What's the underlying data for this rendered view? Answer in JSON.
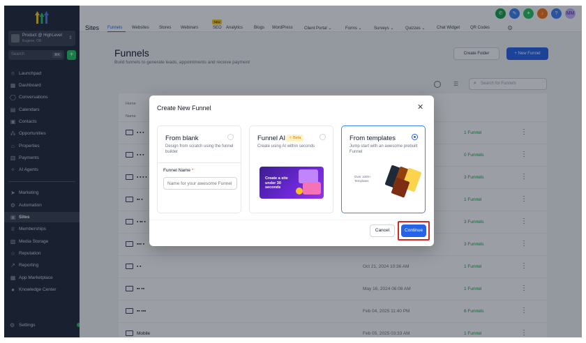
{
  "account": {
    "name": "Product @ HighLevel",
    "location": "Eugene, OR"
  },
  "sidebar": {
    "search_placeholder": "Search",
    "search_shortcut": "⌘K",
    "items": [
      {
        "label": "Launchpad",
        "icon": "rocket-icon"
      },
      {
        "label": "Dashboard",
        "icon": "dashboard-icon"
      },
      {
        "label": "Conversations",
        "icon": "chat-icon"
      },
      {
        "label": "Calendars",
        "icon": "calendar-icon"
      },
      {
        "label": "Contacts",
        "icon": "contacts-icon"
      },
      {
        "label": "Opportunities",
        "icon": "opportunities-icon"
      },
      {
        "label": "Properties",
        "icon": "properties-icon"
      },
      {
        "label": "Payments",
        "icon": "payments-icon"
      },
      {
        "label": "AI Agents",
        "icon": "ai-icon"
      }
    ],
    "items2": [
      {
        "label": "Marketing",
        "icon": "send-icon"
      },
      {
        "label": "Automation",
        "icon": "automation-icon"
      },
      {
        "label": "Sites",
        "icon": "sites-icon"
      },
      {
        "label": "Memberships",
        "icon": "membership-icon"
      },
      {
        "label": "Media Storage",
        "icon": "media-icon"
      },
      {
        "label": "Reputation",
        "icon": "star-icon"
      },
      {
        "label": "Reporting",
        "icon": "chart-icon"
      },
      {
        "label": "App Marketplace",
        "icon": "apps-icon"
      },
      {
        "label": "Knowledge Center",
        "icon": "knowledge-icon"
      }
    ],
    "settings_label": "Settings"
  },
  "topnav": {
    "title": "Sites",
    "tabs": [
      "Funnels",
      "Websites",
      "Stores",
      "Webinars",
      "SEO",
      "Analytics",
      "Blogs",
      "WordPress",
      "Client Portal ⌄",
      "Forms ⌄",
      "Surveys ⌄",
      "Quizzes ⌄",
      "Chat Widget",
      "QR Codes"
    ],
    "new_badge": "New",
    "avatar_initials": "MM",
    "colors": {
      "phone": "#16a34a",
      "accent": "#2563eb",
      "notif": "#f97316",
      "brand": "#2563eb"
    }
  },
  "page": {
    "title": "Funnels",
    "subtitle": "Build funnels to generate leads, appointments and receive payment",
    "create_folder": "Create Folder",
    "new_funnel": "+ New Funnel",
    "search_placeholder": "Search for Funnels",
    "crumb": "Home",
    "col_name": "Name"
  },
  "rows": [
    {
      "name": "▪ ▪ ▪",
      "date": "",
      "count": "1 Funnel"
    },
    {
      "name": "▪ ▪ ▪",
      "date": "",
      "count": "0 Funnels"
    },
    {
      "name": "▪ ▪ ▪ ▪",
      "date": "",
      "count": "3 Funnels"
    },
    {
      "name": "▪▪ ▪",
      "date": "",
      "count": "1 Funnel"
    },
    {
      "name": "▪ ▪▪ ▪",
      "date": "",
      "count": "3 Funnels"
    },
    {
      "name": "▪▪▪ ▪",
      "date": "",
      "count": "3 Funnels"
    },
    {
      "name": "▪ ▪",
      "date": "Oct 21, 2024 10:36 AM",
      "count": "1 Funnel"
    },
    {
      "name": "▪▪ ▪▪",
      "date": "May 16, 2024 06:08 AM",
      "count": "1 Funnel"
    },
    {
      "name": "▪▪ ▪▪▪",
      "date": "Feb 04, 2025 11:40 PM",
      "count": "6 Funnels"
    },
    {
      "name": "Mobile",
      "date": "Feb 05, 2025 03:33 AM",
      "count": "1 Funnel"
    }
  ],
  "modal": {
    "title": "Create New Funnel",
    "cards": [
      {
        "title": "From blank",
        "desc": "Design from scratch using the funnel builder"
      },
      {
        "title": "Funnel AI",
        "desc": "Create using AI within seconds",
        "badge": "✧ Beta"
      },
      {
        "title": "From templates",
        "desc": "Jump start with an awesome prebuilt Funnel"
      }
    ],
    "funnel_name_label": "Funnel Name",
    "required_mark": "*",
    "funnel_name_placeholder": "Name for your awesome Funnel",
    "ai_promo": "Create a site under 30 seconds",
    "templates_promo": "Over 1000+ Templates",
    "cancel": "Cancel",
    "continue": "Continue"
  }
}
